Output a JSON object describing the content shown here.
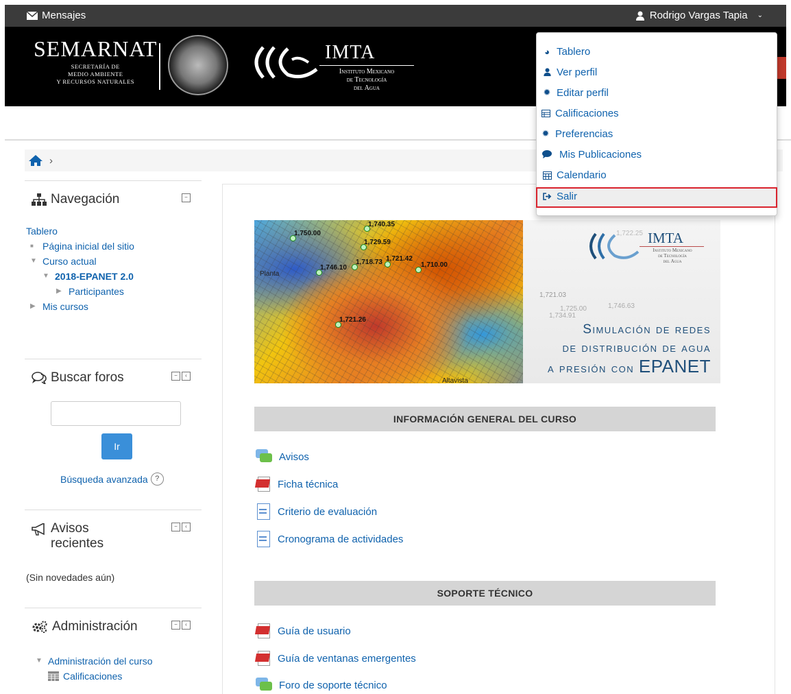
{
  "topbar": {
    "messages": "Mensajes",
    "user_name": "Rodrigo Vargas Tapia"
  },
  "banner": {
    "semarnat": "SEMARNAT",
    "semarnat_sub": [
      "SECRETARÍA DE",
      "MEDIO AMBIENTE",
      "Y RECURSOS NATURALES"
    ],
    "imta": "IMTA",
    "imta_sub": [
      "Instituto Mexicano",
      "de Tecnología",
      "del Agua"
    ]
  },
  "user_menu": {
    "items": [
      {
        "label": "Tablero",
        "icon": "dashboard-icon"
      },
      {
        "label": "Ver perfil",
        "icon": "user-icon"
      },
      {
        "label": "Editar perfil",
        "icon": "cog-icon"
      },
      {
        "label": "Calificaciones",
        "icon": "table-icon"
      },
      {
        "label": "Preferencias",
        "icon": "cog-icon"
      },
      {
        "label": "Mis Publicaciones",
        "icon": "comment-icon"
      },
      {
        "label": "Calendario",
        "icon": "calendar-icon"
      },
      {
        "label": "Salir",
        "icon": "sign-out-icon"
      }
    ],
    "highlighted": "Salir",
    "highlight_color": "#d9232d"
  },
  "breadcrumb": {
    "separator": "›"
  },
  "navigation": {
    "title": "Navegación",
    "items": [
      {
        "label": "Tablero"
      },
      {
        "label": "Página inicial del sitio"
      },
      {
        "label": "Curso actual"
      },
      {
        "label": "2018-EPANET 2.0"
      },
      {
        "label": "Participantes"
      },
      {
        "label": "Mis cursos"
      }
    ]
  },
  "search_forums": {
    "title": "Buscar foros",
    "button": "Ir",
    "advanced": "Búsqueda avanzada",
    "help": "?"
  },
  "recent_news": {
    "title_line1": "Avisos",
    "title_line2": "recientes",
    "empty": "(Sin novedades aún)"
  },
  "administration": {
    "title": "Administración",
    "items": [
      {
        "label": "Administración del curso"
      },
      {
        "label": "Calificaciones"
      }
    ]
  },
  "hero": {
    "labels": [
      "1,750.00",
      "1,740.35",
      "1,729.59",
      "1,746.10",
      "1,718.73",
      "1,721.42",
      "1,710.00",
      "1,721.26",
      "Planta",
      "Altavista",
      "1,722.25",
      "1,721.03",
      "1,725.00",
      "1,734.91",
      "1,746.63"
    ],
    "title_lines": [
      "Simulación de redes",
      "de distribución de agua",
      "a presión con"
    ],
    "title_big": "EPANET",
    "imta": "IMTA",
    "imta_sub": [
      "Instituto Mexicano",
      "de Tecnología",
      "del Agua"
    ]
  },
  "sections": [
    {
      "title": "INFORMACIÓN GENERAL DEL CURSO",
      "activities": [
        {
          "label": "Avisos",
          "icon": "forum-icon"
        },
        {
          "label": "Ficha técnica",
          "icon": "pdf-icon"
        },
        {
          "label": "Criterio de evaluación",
          "icon": "page-icon"
        },
        {
          "label": "Cronograma de actividades",
          "icon": "page-icon"
        }
      ]
    },
    {
      "title": "SOPORTE TÉCNICO",
      "activities": [
        {
          "label": "Guía de usuario",
          "icon": "pdf-icon"
        },
        {
          "label": "Guía de ventanas emergentes",
          "icon": "pdf-icon"
        },
        {
          "label": "Foro de soporte técnico",
          "icon": "forum-icon"
        }
      ]
    }
  ]
}
